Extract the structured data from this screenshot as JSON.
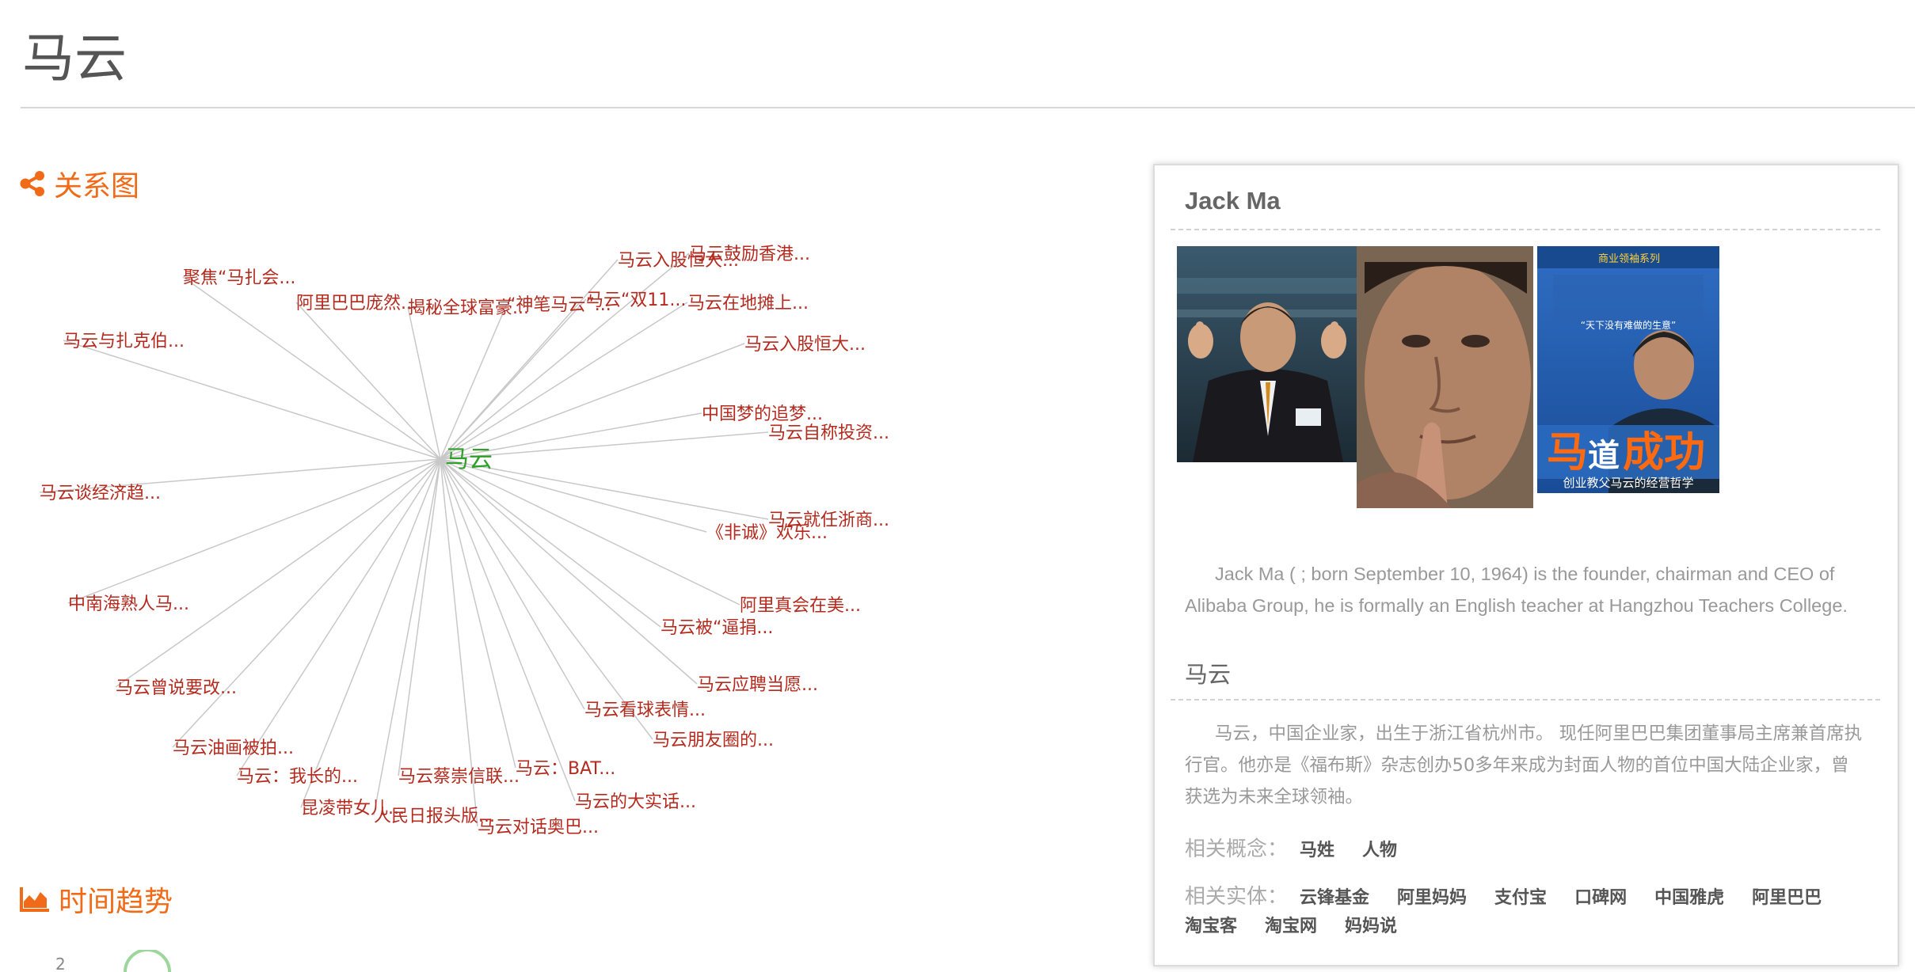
{
  "page": {
    "title": "马云"
  },
  "graph": {
    "heading": "关系图",
    "center": "马云",
    "nodes": [
      "马云鼓励香港...",
      "马云入股恒大...",
      "聚焦“马扎会...",
      "阿里巴巴庞然...",
      "揭秘全球富豪...",
      "“神笔马云”...",
      "马云“双11...",
      "马云在地摊上...",
      "马云与扎克伯...",
      "马云入股恒大...",
      "中国梦的追梦...",
      "马云自称投资...",
      "马云谈经济趋...",
      "马云就任浙商...",
      "《非诚》欢乐...",
      "中南海熟人马...",
      "阿里真会在美...",
      "马云被“逼捐...",
      "马云曾说要改...",
      "马云应聘当愿...",
      "马云看球表情...",
      "马云油画被拍...",
      "马云朋友圈的...",
      "马云：BAT...",
      "马云：我长的...",
      "马云蔡崇信联...",
      "马云的大实话...",
      "昆凌带女儿...",
      "人民日报头版...",
      "马云对话奥巴..."
    ]
  },
  "trend": {
    "heading": "时间趋势",
    "axis_tick": "2"
  },
  "card": {
    "en_title": "Jack Ma",
    "photo3_tagline": "“天下没有难做的生意”",
    "photo3_title_a": "马",
    "photo3_title_b": "成功",
    "photo3_sub": "创业教父马云的经营哲学",
    "photo3_banner": "商业领袖系列",
    "en_desc": "Jack Ma ( ; born September 10, 1964) is the founder, chairman and CEO of Alibaba Group, he is formally an English teacher at Hangzhou Teachers College.",
    "cn_title": "马云",
    "cn_desc": "马云，中国企业家，出生于浙江省杭州市。 现任阿里巴巴集团董事局主席兼首席执行官。他亦是《福布斯》杂志创办50多年来成为封面人物的首位中国大陆企业家，曾获选为未来全球领袖。",
    "concepts_label": "相关概念：",
    "concepts": [
      "马姓",
      "人物"
    ],
    "entities_label": "相关实体：",
    "entities": [
      "云锋基金",
      "阿里妈妈",
      "支付宝",
      "口碑网",
      "中国雅虎",
      "阿里巴巴",
      "淘宝客",
      "淘宝网",
      "妈妈说"
    ]
  },
  "colors": {
    "accent": "#f06a17",
    "node_text": "#b42a1e",
    "center_text": "#2fa028",
    "edge": "#c8c8c8"
  }
}
